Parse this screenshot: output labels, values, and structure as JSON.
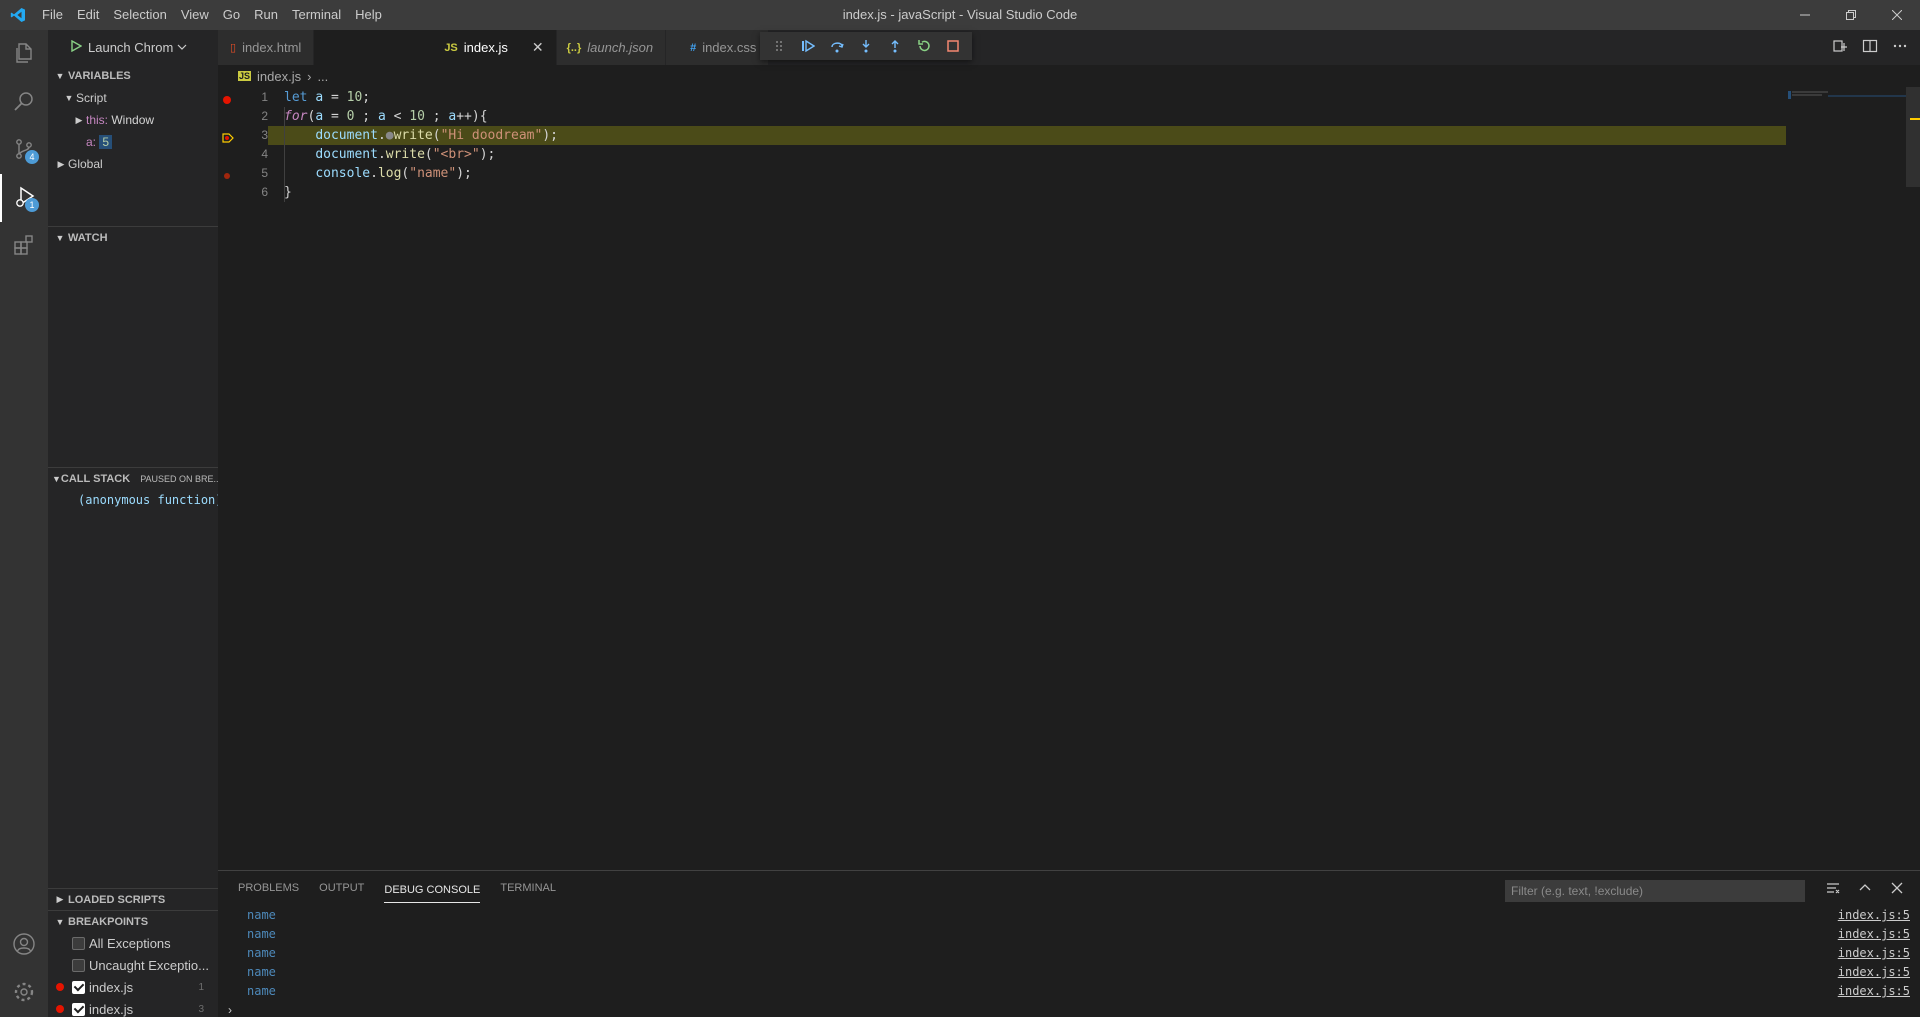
{
  "window": {
    "title": "index.js - javaScript - Visual Studio Code",
    "menu": [
      "File",
      "Edit",
      "Selection",
      "View",
      "Go",
      "Run",
      "Terminal",
      "Help"
    ]
  },
  "activity": {
    "scm_badge": "4",
    "debug_badge": "1"
  },
  "sidebar": {
    "launch_config": "Launch Chrom",
    "variables": {
      "header": "VARIABLES",
      "script": "Script",
      "this_name": "this:",
      "this_value": "Window",
      "a_name": "a:",
      "a_value": "5",
      "global": "Global"
    },
    "watch_header": "WATCH",
    "callstack": {
      "header": "CALL STACK",
      "status": "PAUSED ON BRE...",
      "frame": "(anonymous function)"
    },
    "loaded_scripts_header": "LOADED SCRIPTS",
    "breakpoints": {
      "header": "BREAKPOINTS",
      "items": [
        {
          "label": "All Exceptions",
          "checked": false
        },
        {
          "label": "Uncaught Exceptio...",
          "checked": false
        },
        {
          "label": "index.js",
          "checked": true,
          "line": "1"
        },
        {
          "label": "index.js",
          "checked": true,
          "line": "3"
        }
      ]
    }
  },
  "tabs": [
    {
      "label": "index.html",
      "icon": "html-file-icon"
    },
    {
      "label": "index.js",
      "icon": "js-file-icon",
      "active": true
    },
    {
      "label": "launch.json",
      "icon": "json-file-icon",
      "italic": true
    },
    {
      "label": "index.css",
      "icon": "css-file-icon"
    }
  ],
  "breadcrumb": {
    "file": "index.js",
    "rest": "..."
  },
  "editor": {
    "line_numbers": [
      "1",
      "2",
      "3",
      "4",
      "5",
      "6"
    ],
    "current_line": 3,
    "breakpoint_lines": [
      1,
      3,
      5
    ]
  },
  "panel": {
    "tabs": [
      "PROBLEMS",
      "OUTPUT",
      "DEBUG CONSOLE",
      "TERMINAL"
    ],
    "active_tab": "DEBUG CONSOLE",
    "filter_placeholder": "Filter (e.g. text, !exclude)",
    "lines": [
      {
        "msg": "name",
        "src": "index.js:5"
      },
      {
        "msg": "name",
        "src": "index.js:5"
      },
      {
        "msg": "name",
        "src": "index.js:5"
      },
      {
        "msg": "name",
        "src": "index.js:5"
      },
      {
        "msg": "name",
        "src": "index.js:5"
      }
    ],
    "prompt": "›"
  },
  "colors": {
    "accent": "#007acc",
    "current_line": "#4b4b18",
    "breakpoint": "#e51400"
  }
}
